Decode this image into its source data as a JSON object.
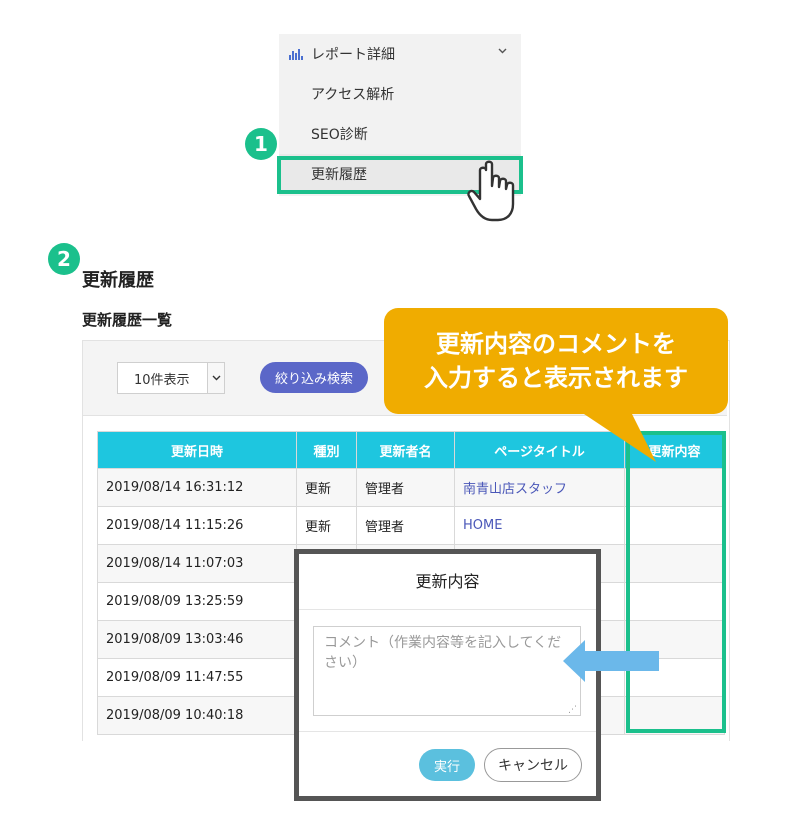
{
  "step1": {
    "badge": "1",
    "menu": {
      "header_label": "レポート詳細",
      "items": [
        "アクセス解析",
        "SEO診断",
        "更新履歴"
      ]
    }
  },
  "step2": {
    "badge": "2",
    "page_title": "更新履歴",
    "section_title": "更新履歴一覧",
    "toolbar": {
      "per_page_value": "10件表示",
      "filter_button": "絞り込み検索"
    },
    "table": {
      "headers": [
        "更新日時",
        "種別",
        "更新者名",
        "ページタイトル",
        "更新内容"
      ],
      "rows": [
        [
          "2019/08/14 16:31:12",
          "更新",
          "管理者",
          "南青山店スタッフ",
          ""
        ],
        [
          "2019/08/14 11:15:26",
          "更新",
          "管理者",
          "HOME",
          ""
        ],
        [
          "2019/08/14 11:07:03",
          "",
          "",
          "",
          ""
        ],
        [
          "2019/08/09 13:25:59",
          "",
          "",
          "",
          ""
        ],
        [
          "2019/08/09 13:03:46",
          "",
          "",
          "",
          ""
        ],
        [
          "2019/08/09 11:47:55",
          "",
          "",
          "",
          ""
        ],
        [
          "2019/08/09 10:40:18",
          "",
          "",
          "",
          ""
        ]
      ]
    },
    "callout": {
      "line1": "更新内容のコメントを",
      "line2": "入力すると表示されます"
    },
    "modal": {
      "title": "更新内容",
      "textarea_placeholder": "コメント（作業内容等を記入してください）",
      "run_button": "実行",
      "cancel_button": "キャンセル"
    }
  },
  "colors": {
    "highlight_green": "#1bc08c",
    "table_header": "#1ec6df",
    "callout": "#f0ac00",
    "filter_button": "#5b67c8",
    "run_button": "#5bc0de",
    "link": "#4a57b8",
    "arrow": "#6bb8ea"
  },
  "icons": {
    "menu_header": "bar-chart-icon",
    "menu_toggle": "chevron-down-icon",
    "cursor": "hand-pointer-icon",
    "select_toggle": "caret-down-icon",
    "arrow": "arrow-left-icon"
  }
}
